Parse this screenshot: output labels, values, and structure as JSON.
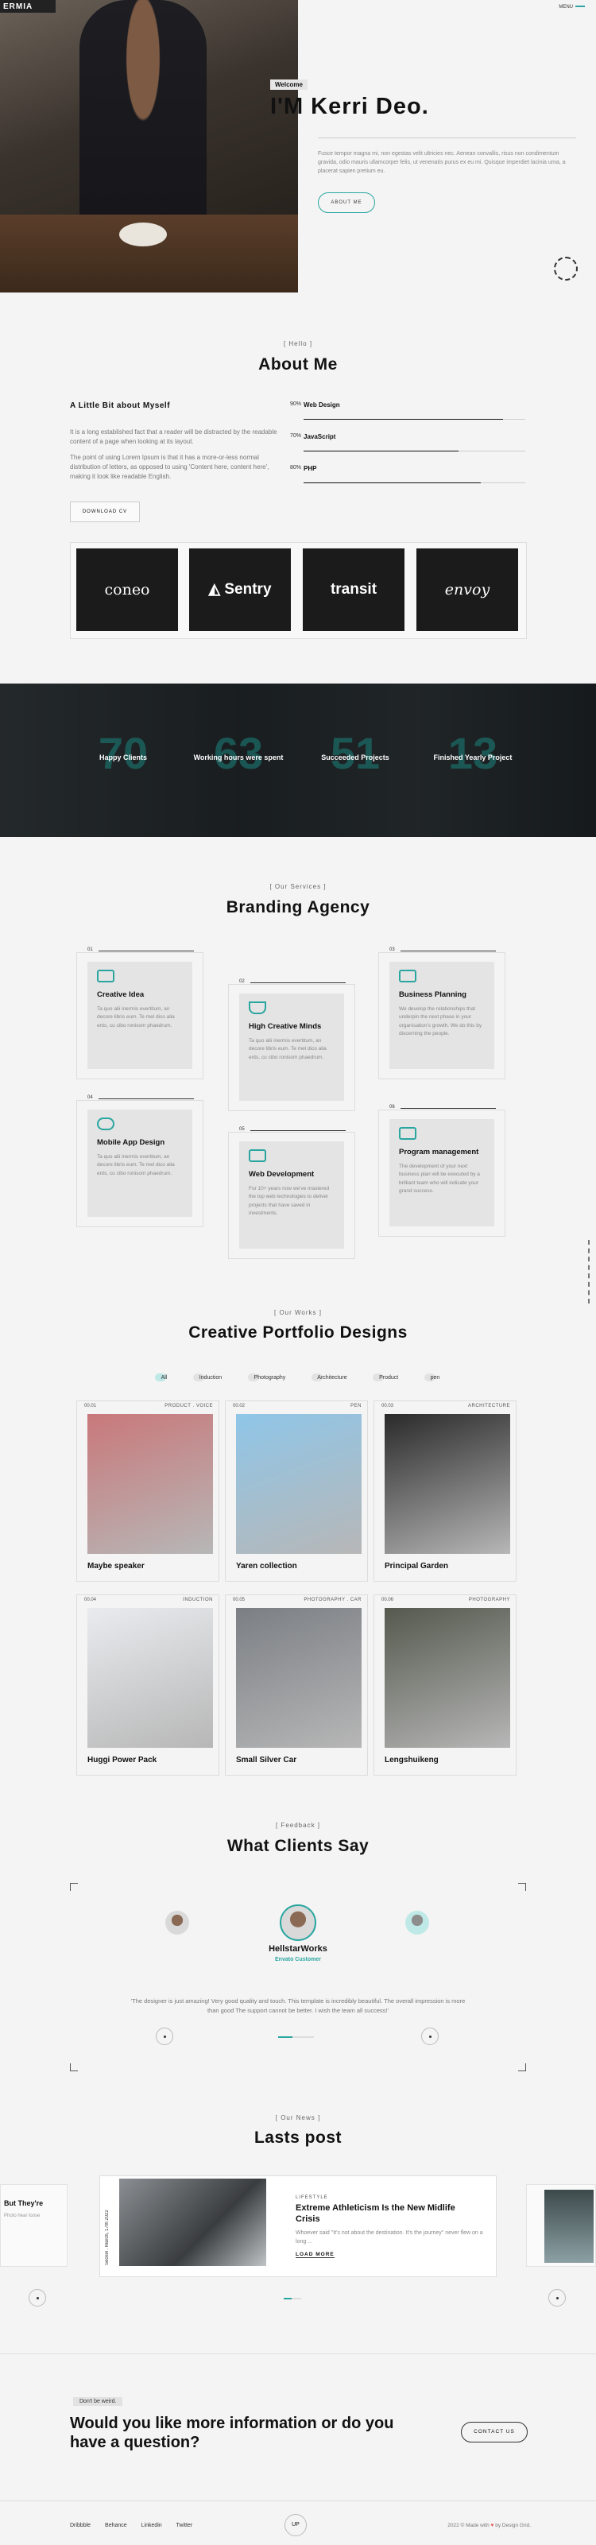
{
  "header": {
    "brand": "ERMIA",
    "menu": "MENU"
  },
  "hero": {
    "welcome": "Welcome",
    "name": "I'M Kerri Deo.",
    "description": "Fusce tempor magna mi, non egestas velit ultricies nec. Aenean convallis, risus non condimentum gravida, odio mauris ullamcorper felis, ut venenatis purus ex eu mi. Quisque imperdiet lacinia urna, a placerat sapien pretium eu.",
    "button": "ABOUT ME"
  },
  "about": {
    "eyebrow": "[ Hello ]",
    "title": "About Me",
    "subtitle": "A Little Bit about Myself",
    "p1": "It is a long established fact that a reader will be distracted by the readable content of a page when looking at its layout.",
    "p2": "The point of using Lorem Ipsum is that it has a more-or-less normal distribution of letters, as opposed to using 'Content here, content here', making it look like readable English.",
    "cv_button": "DOWNLOAD CV",
    "skills": [
      {
        "pct": "90%",
        "name": "Web Design",
        "value": 90
      },
      {
        "pct": "70%",
        "name": "JavaScript",
        "value": 70
      },
      {
        "pct": "80%",
        "name": "PHP",
        "value": 80
      }
    ],
    "logos": [
      "coneo",
      "Sentry",
      "transit",
      "envoy"
    ]
  },
  "stats": [
    {
      "num": "70",
      "label": "Happy Clients"
    },
    {
      "num": "63",
      "label": "Working hours were spent"
    },
    {
      "num": "51",
      "label": "Succeeded Projects"
    },
    {
      "num": "13",
      "label": "Finished Yearly Project"
    }
  ],
  "services": {
    "eyebrow": "[ Our Services ]",
    "title": "Branding Agency",
    "items": [
      {
        "num": "01",
        "title": "Creative Idea",
        "desc": "Ta quo alii inermis evertitum, an decore libris eum. Te mel dico alia ents, cu cibo ronisom phaedrum."
      },
      {
        "num": "02",
        "title": "High Creative Minds",
        "desc": "Ta quo alii inermis evertitum, an decore libris eum. Te mel dico alia ents, cu cibo ronisom phaedrum."
      },
      {
        "num": "03",
        "title": "Business Planning",
        "desc": "We develop the relationships that underpin the next phase in your organisation's growth. We do this by discerning the people."
      },
      {
        "num": "04",
        "title": "Mobile App Design",
        "desc": "Ta quo alii inermis evertitum, an decore libris eum. Te mel dico alia ents, cu cibo ronisom phaedrum."
      },
      {
        "num": "05",
        "title": "Web Development",
        "desc": "For 10+ years now we've mastered the top web technologies to deliver projects that have saved in investments."
      },
      {
        "num": "06",
        "title": "Program management",
        "desc": "The development of your next business plan will be executed by a brilliant team who will indicate your grand success."
      }
    ]
  },
  "portfolio": {
    "eyebrow": "[ Our Works ]",
    "title": "Creative Portfolio Designs",
    "filters": [
      "All",
      "Induction",
      "Photography",
      "Architecture",
      "Product",
      "pen"
    ],
    "works": [
      {
        "no": "00.01",
        "cat": "PRODUCT . VOICE",
        "title": "Maybe speaker",
        "color": "#c9787a"
      },
      {
        "no": "00.02",
        "cat": "PEN",
        "title": "Yaren collection",
        "color": "#8fc6e8"
      },
      {
        "no": "00.03",
        "cat": "ARCHITECTURE",
        "title": "Principal Garden",
        "color": "#2a2a2a"
      },
      {
        "no": "00.04",
        "cat": "INDUCTION",
        "title": "Huggi Power Pack",
        "color": "#e9ebee"
      },
      {
        "no": "00.05",
        "cat": "PHOTOGRAPHY . CAR",
        "title": "Small Silver Car",
        "color": "#7b7f84"
      },
      {
        "no": "00.06",
        "cat": "PHOTOGRAPHY",
        "title": "Lengshuikeng",
        "color": "#55594e"
      }
    ]
  },
  "testimonials": {
    "eyebrow": "[ Feedback ]",
    "title": "What Clients Say",
    "name": "HellstarWorks",
    "role": "Envato Customer",
    "quote": "'The designer is just amazing! Very good quality and touch. This template is incredibly beautiful. The overall impression is more than good The support cannot be better. I wish the team all success!'"
  },
  "blog": {
    "eyebrow": "[ Our News ]",
    "title": "Lasts post",
    "date": "Seckel . March, 17th 2022",
    "category": "LIFESTYLE",
    "heading": "Extreme Athleticism Is the New Midlife Crisis",
    "excerpt": "Whoever said \"It's not about the destination. It's the journey\" never flew on a long ...",
    "more": "LOAD MORE",
    "ghost_left_title": "But They're",
    "ghost_left_sub": "Photo hear loose"
  },
  "cta": {
    "pill": "Don't be weird.",
    "title": "Would you like more information or do you have a question?",
    "button": "CONTACT US"
  },
  "footer": {
    "links": [
      "Dribbble",
      "Behance",
      "Linkedin",
      "Twitter"
    ],
    "copy": "2022 © Made with",
    "copy_by": "by Design Grid.",
    "up": "UP"
  }
}
